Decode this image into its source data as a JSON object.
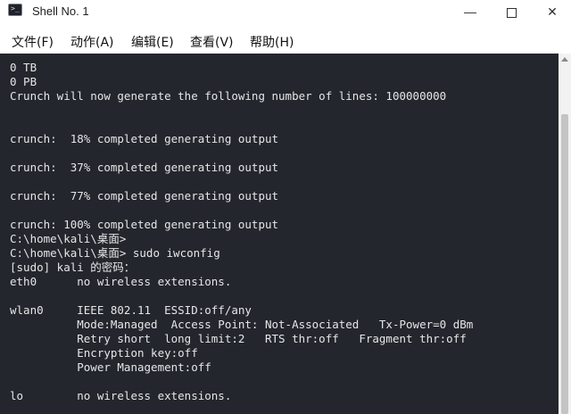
{
  "window": {
    "title": "Shell No. 1",
    "icon": "terminal-icon",
    "controls": {
      "minimize_glyph": "—",
      "maximize_icon": "maximize-icon",
      "close_glyph": "✕"
    }
  },
  "menu": [
    {
      "label": "文件(F)"
    },
    {
      "label": "动作(A)"
    },
    {
      "label": "编辑(E)"
    },
    {
      "label": "查看(V)"
    },
    {
      "label": "帮助(H)"
    }
  ],
  "terminal": {
    "lines": [
      "0 TB",
      "0 PB",
      "Crunch will now generate the following number of lines: 100000000",
      "",
      "",
      "crunch:  18% completed generating output",
      "",
      "crunch:  37% completed generating output",
      "",
      "crunch:  77% completed generating output",
      "",
      "crunch: 100% completed generating output",
      "C:\\home\\kali\\桌面>",
      "C:\\home\\kali\\桌面> sudo iwconfig",
      "[sudo] kali 的密码：",
      "eth0      no wireless extensions.",
      "",
      "wlan0     IEEE 802.11  ESSID:off/any",
      "          Mode:Managed  Access Point: Not-Associated   Tx-Power=0 dBm",
      "          Retry short  long limit:2   RTS thr:off   Fragment thr:off",
      "          Encryption key:off",
      "          Power Management:off",
      "",
      "lo        no wireless extensions."
    ]
  },
  "colors": {
    "terminal_bg": "#23262d",
    "terminal_fg": "#e6e6e6",
    "titlebar_bg": "#ffffff",
    "scrollbar_bg": "#f2f2f2"
  }
}
